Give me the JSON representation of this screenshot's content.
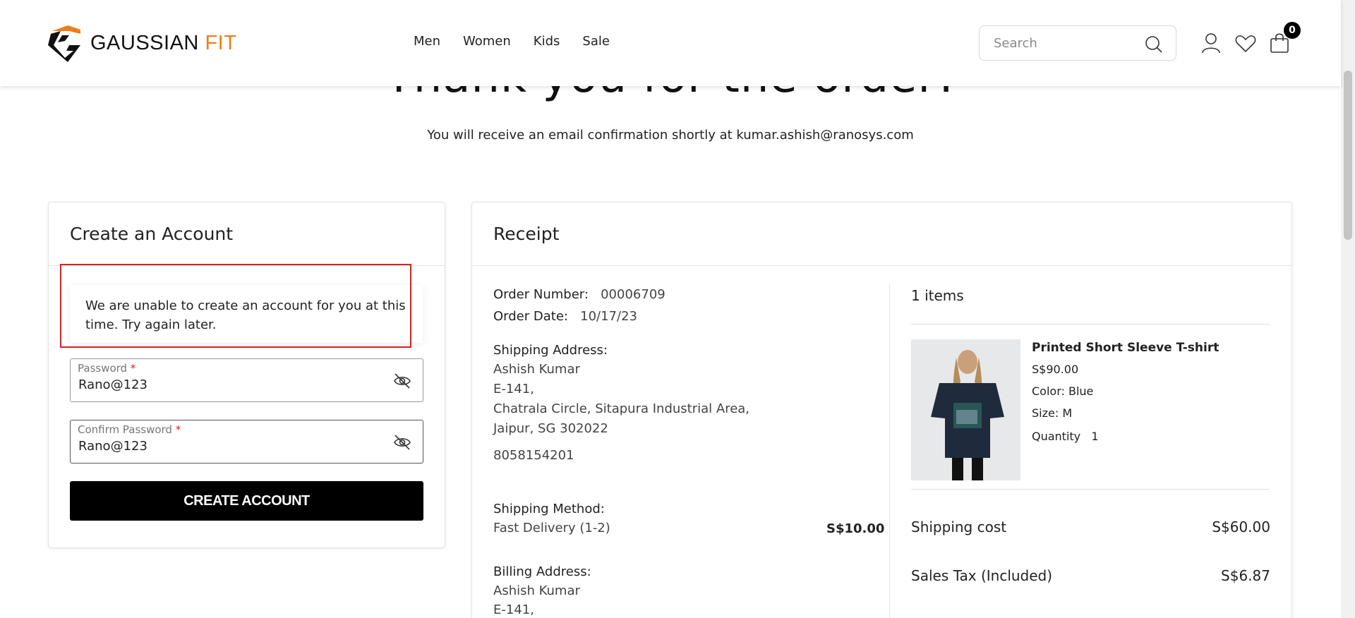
{
  "header": {
    "brand_main": "GAUSSIAN",
    "brand_accent": "FIT",
    "nav": [
      "Men",
      "Women",
      "Kids",
      "Sale"
    ],
    "search_placeholder": "Search",
    "cart_count": "0"
  },
  "hero": {
    "title": "Thank you for the order!",
    "subtitle": "You will receive an email confirmation shortly at kumar.ashish@ranosys.com"
  },
  "create_account": {
    "title": "Create an Account",
    "error_message": "We are unable to create an account for you at this time. Try again later.",
    "password_label": "Password",
    "password_value": "Rano@123",
    "confirm_label": "Confirm Password",
    "confirm_value": "Rano@123",
    "required_mark": "*",
    "button_label": "CREATE ACCOUNT"
  },
  "receipt": {
    "title": "Receipt",
    "order_number_label": "Order Number:",
    "order_number": "00006709",
    "order_date_label": "Order Date:",
    "order_date": "10/17/23",
    "shipping_address_label": "Shipping Address:",
    "shipping_address": [
      "Ashish Kumar",
      "E-141,",
      "Chatrala Circle, Sitapura Industrial Area,",
      "Jaipur, SG 302022"
    ],
    "phone": "8058154201",
    "shipping_method_label": "Shipping Method:",
    "shipping_method": "Fast Delivery (1-2)",
    "shipping_method_price": "S$10.00",
    "billing_address_label": "Billing Address:",
    "billing_address": [
      "Ashish Kumar",
      "E-141,"
    ],
    "items_count": "1 items",
    "product": {
      "name": "Printed Short Sleeve T-shirt",
      "price": "S$90.00",
      "color": "Color: Blue",
      "size": "Size: M",
      "quantity_label": "Quantity",
      "quantity": "1"
    },
    "shipping_cost_label": "Shipping cost",
    "shipping_cost": "S$60.00",
    "sales_tax_label": "Sales Tax (Included)",
    "sales_tax": "S$6.87"
  },
  "colors": {
    "accent": "#f07d1a",
    "error": "#d9231f",
    "button": "#000000"
  }
}
